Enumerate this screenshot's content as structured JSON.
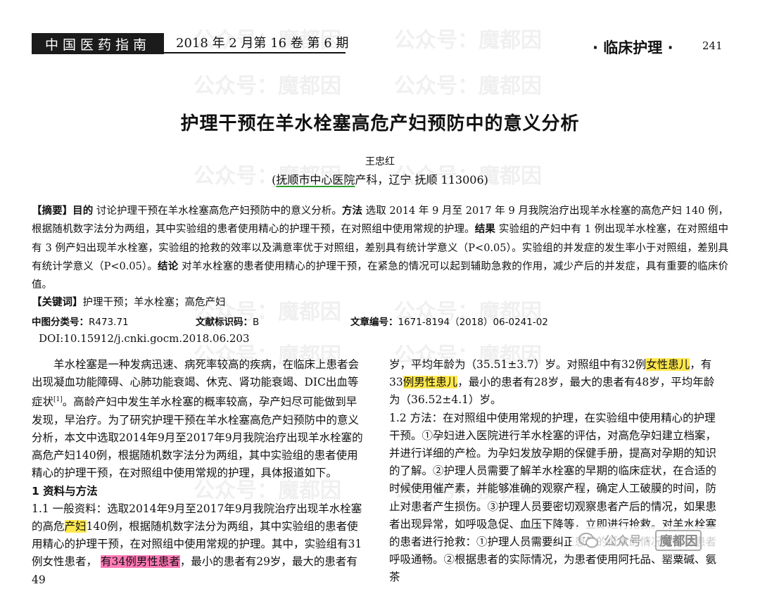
{
  "header": {
    "journal": "中国医药指南",
    "issue": "2018 年 2 月第 16 卷  第 6 期",
    "section": "· 临床护理 ·",
    "page": "241"
  },
  "article": {
    "title": "护理干预在羊水栓塞高危产妇预防中的意义分析",
    "author": "王忠红",
    "affil_pre": "(",
    "affil_hospital": "抚顺市中心医院",
    "affil_post": "产科，辽宁 抚顺 113006)"
  },
  "abstract": {
    "label": "【摘要】",
    "s1_label": "目的",
    "s1": " 讨论护理干预在羊水栓塞高危产妇预防中的意义分析。",
    "s2_label": "方法",
    "s2": " 选取 2014 年 9 月至 2017 年 9 月我院治疗出现羊水栓塞的高危产妇 140 例，根据随机数字法分为两组，其中实验组的患者使用精心的护理干预，在对照组中使用常规的护理。",
    "s3_label": "结果",
    "s3": " 实验组的产妇中有 1 例出现羊水栓塞，在对照组中有 3 例产妇出现羊水栓塞，实验组的抢救的效率以及满意率优于对照组，差别具有统计学意义（P<0.05）。实验组的并发症的发生率小于对照组，差别具有统计学意义（P<0.05）。",
    "s4_label": "结论",
    "s4": " 对羊水栓塞的患者使用精心的护理干预，在紧急的情况可以起到辅助急救的作用，减少产后的并发症，具有重要的临床价值。"
  },
  "keywords": {
    "label": "【关键词】",
    "text": "护理干预；羊水栓塞；高危产妇"
  },
  "meta": {
    "clc_label": "中图分类号：",
    "clc": "R473.71",
    "doc_label": "文献标识码：",
    "doc": "B",
    "article_label": "文章编号：",
    "article_no": "1671-8194（2018）06-0241-02",
    "doi": "DOI:10.15912/j.cnki.gocm.2018.06.203"
  },
  "left_column": {
    "p1a": "羊水栓塞是一种发病迅速、病死率较高的疾病，在临床上患者会出现凝血功能障碍、心肺功能衰竭、休克、肾功能衰竭、DIC出血等症状",
    "p1_ref": "[1]",
    "p1b": "。高龄产妇中发生羊水栓塞的概率较高，孕产妇尽可能做到早发现，早治疗。为了研究护理干预在羊水栓塞高危产妇预防中的意义分析，本文中选取2014年9月至2017年9月我院治疗出现羊水栓塞的高危产妇140例，根据随机数字法分为两组，其中实验组的患者使用精心的护理干预，在对照组中使用常规的护理，具体报道如下。",
    "h1": "1  资料与方法",
    "p2a": "1.1  一般资料：选取2014年9月至2017年9月我院治疗出现羊水栓塞的高危",
    "p2_hl1": "产妇",
    "p2b": "140例，根据随机数字法分为两组，其中实验组的患者使用精心的护理干预，在对照组中使用常规的护理。其中，实验组有31例",
    "p2_hl2": "女性患者，",
    "p2c": " ",
    "p2_hl3": "有34例男性患者",
    "p2d": "，最小的患者有29岁，最大的患者有49"
  },
  "right_column": {
    "p1a": "岁，平均年龄为（35.51±3.7）岁。对照组中有32例",
    "p1_hl1": "女性患儿",
    "p1b": "，有33",
    "p1_hl2": "例男性患儿",
    "p1c": "，最小的患者有28岁，最大的患者有48岁，平均年龄为（36.52±4.1）岁。",
    "p2": "1.2  方法：在对照组中使用常规的护理，在实验组中使用精心的护理干预。①孕妇进入医院进行羊水栓塞的评估，对高危孕妇建立档案，并进行详细的产检。为孕妇发放孕期的保健手册，提高对孕期的知识的了解。②护理人员需要了解羊水栓塞的早期的临床症状，在合适的时候使用催产素，并能够准确的观察产程，确定人工破膜的时间，防止对患者产生损伤。③护理人员要密切观察患者产后的情况，如果患者出现异常，如呼吸急促、血压下降等，立即进行抢救。对羊水栓塞的患者进行抢救：①护理人员需要纠正患者的低氧的情况，保持患者呼吸通畅。②根据患者的实际情况，为患者使用阿托品、罂粟碱、氨茶"
  },
  "watermark": {
    "text": "公众号：魔都因",
    "badge_text": "公众号 · ",
    "badge_brand": "魔都因"
  }
}
